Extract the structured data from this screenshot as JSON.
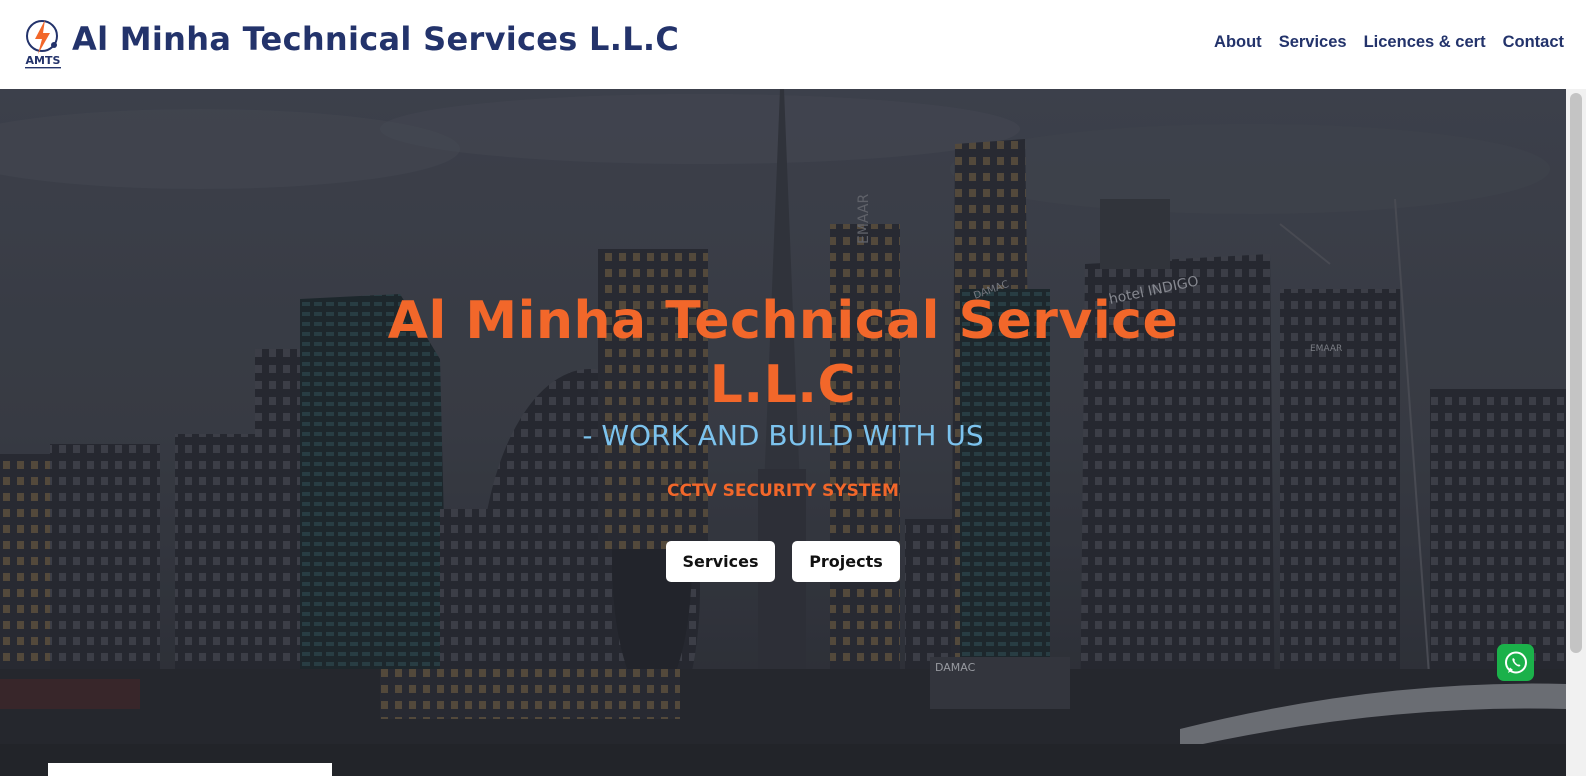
{
  "header": {
    "logo_text": "AMTS",
    "brand_title": "Al Minha Technical Services L.L.C"
  },
  "nav": {
    "items": [
      {
        "label": "About"
      },
      {
        "label": "Services"
      },
      {
        "label": "Licences & cert"
      },
      {
        "label": "Contact"
      }
    ]
  },
  "hero": {
    "title": "Al Minha Technical Service L.L.C",
    "tagline": "- WORK AND BUILD WITH US",
    "service_text": "CCTV SECURITY SYSTEM",
    "buttons": {
      "services_label": "Services",
      "projects_label": "Projects"
    },
    "background_signs": [
      "EMAAR",
      "DAMAC",
      "hotel INDIGO",
      "EMAAR",
      "DAMAC"
    ]
  },
  "whatsapp": {
    "icon": "whatsapp-icon"
  },
  "colors": {
    "brand_navy": "#23336b",
    "accent_orange": "#f2672a",
    "tagline_blue": "#7cc3ee",
    "whatsapp_green": "#1bb14a"
  }
}
